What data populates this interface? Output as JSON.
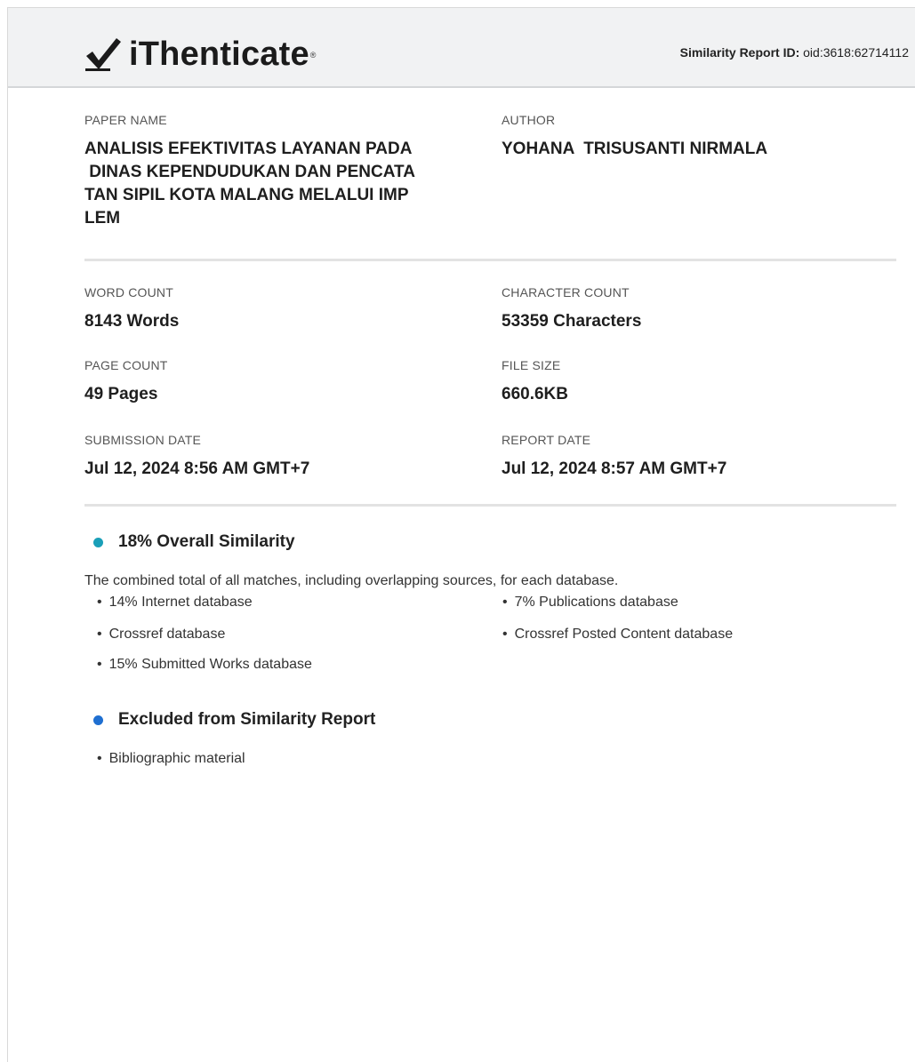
{
  "header": {
    "logo_text": "iThenticate",
    "logo_reg": "®",
    "report_id_label": "Similarity Report ID:",
    "report_id_value": "oid:3618:62714112"
  },
  "fields": {
    "paper_name_label": "PAPER NAME",
    "paper_name_lines": [
      "ANALISIS EFEKTIVITAS LAYANAN PADA",
      " DINAS KEPENDUDUKAN DAN PENCATA",
      "TAN SIPIL KOTA MALANG MELALUI IMP",
      "LEM"
    ],
    "author_label": "AUTHOR",
    "author_value": "YOHANA  TRISUSANTI NIRMALA",
    "word_count_label": "WORD COUNT",
    "word_count_value": "8143 Words",
    "character_count_label": "CHARACTER COUNT",
    "character_count_value": "53359 Characters",
    "page_count_label": "PAGE COUNT",
    "page_count_value": "49 Pages",
    "file_size_label": "FILE SIZE",
    "file_size_value": "660.6KB",
    "submission_date_label": "SUBMISSION DATE",
    "submission_date_value": "Jul 12, 2024 8:56 AM GMT+7",
    "report_date_label": "REPORT DATE",
    "report_date_value": "Jul 12, 2024 8:57 AM GMT+7"
  },
  "similarity": {
    "heading": "18% Overall Similarity",
    "dot_color": "#1a9fb8",
    "description": "The combined total of all matches, including overlapping sources, for each database.",
    "items_left": [
      "14% Internet database",
      "Crossref database",
      "15% Submitted Works database"
    ],
    "items_right": [
      "7% Publications database",
      "Crossref Posted Content database"
    ]
  },
  "excluded": {
    "heading": "Excluded from Similarity Report",
    "dot_color": "#1f6fd1",
    "items": [
      "Bibliographic material"
    ]
  }
}
